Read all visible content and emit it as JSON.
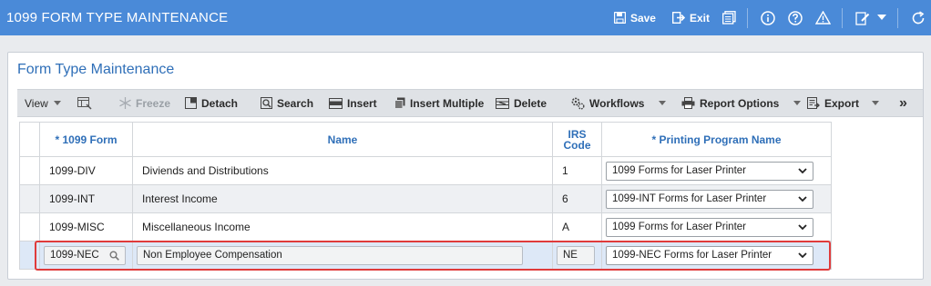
{
  "app": {
    "title": "1099 FORM TYPE MAINTENANCE"
  },
  "titlebar": {
    "save_label": "Save",
    "exit_label": "Exit",
    "icons": [
      "save-icon",
      "exit-icon",
      "report-icon",
      "info-icon",
      "help-icon",
      "warning-icon",
      "edit-icon",
      "chevron-down-icon",
      "refresh-icon"
    ]
  },
  "panel": {
    "title": "Form Type Maintenance"
  },
  "toolbar": {
    "view_label": "View",
    "freeze_label": "Freeze",
    "detach_label": "Detach",
    "search_label": "Search",
    "insert_label": "Insert",
    "insert_multiple_label": "Insert Multiple",
    "delete_label": "Delete",
    "workflows_label": "Workflows",
    "report_options_label": "Report Options",
    "export_label": "Export",
    "more_label": "»"
  },
  "table": {
    "columns": [
      "* 1099 Form",
      "Name",
      "IRS Code",
      "* Printing Program Name"
    ],
    "rows": [
      {
        "form": "1099-DIV",
        "name": "Diviends and Distributions",
        "code": "1",
        "program": "1099 Forms for Laser Printer"
      },
      {
        "form": "1099-INT",
        "name": "Interest Income",
        "code": "6",
        "program": "1099-INT Forms for Laser Printer"
      },
      {
        "form": "1099-MISC",
        "name": "Miscellaneous Income",
        "code": "A",
        "program": "1099 Forms for Laser Printer"
      },
      {
        "form": "1099-NEC",
        "name": "Non Employee Compensation",
        "code": "NE",
        "program": "1099-NEC Forms for Laser Printer"
      }
    ]
  },
  "colors": {
    "titlebar": "#4a8ad8",
    "accent": "#2f6fb8",
    "highlight": "#e03b3b"
  }
}
